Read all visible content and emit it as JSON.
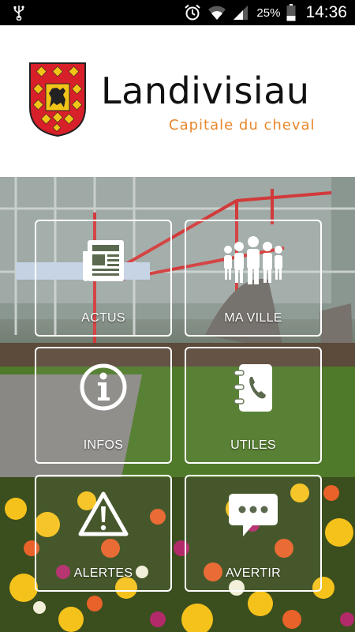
{
  "status_bar": {
    "battery_percent": "25%",
    "time": "14:36",
    "icons": [
      "usb-icon",
      "alarm-icon",
      "wifi-icon",
      "signal-icon",
      "battery-icon"
    ]
  },
  "header": {
    "title": "Landivisiau",
    "subtitle": "Capitale du cheval"
  },
  "colors": {
    "subtitle": "#e8862a",
    "crest_red": "#d8202a",
    "crest_gold": "#f2c418",
    "tile_border": "#ffffff"
  },
  "tiles": [
    {
      "label": "ACTUS",
      "icon": "newspaper-icon"
    },
    {
      "label": "MA VILLE",
      "icon": "people-icon"
    },
    {
      "label": "INFOS",
      "icon": "info-icon"
    },
    {
      "label": "UTILES",
      "icon": "phonebook-icon"
    },
    {
      "label": "ALERTES",
      "icon": "warning-icon"
    },
    {
      "label": "AVERTIR",
      "icon": "chat-icon"
    }
  ]
}
